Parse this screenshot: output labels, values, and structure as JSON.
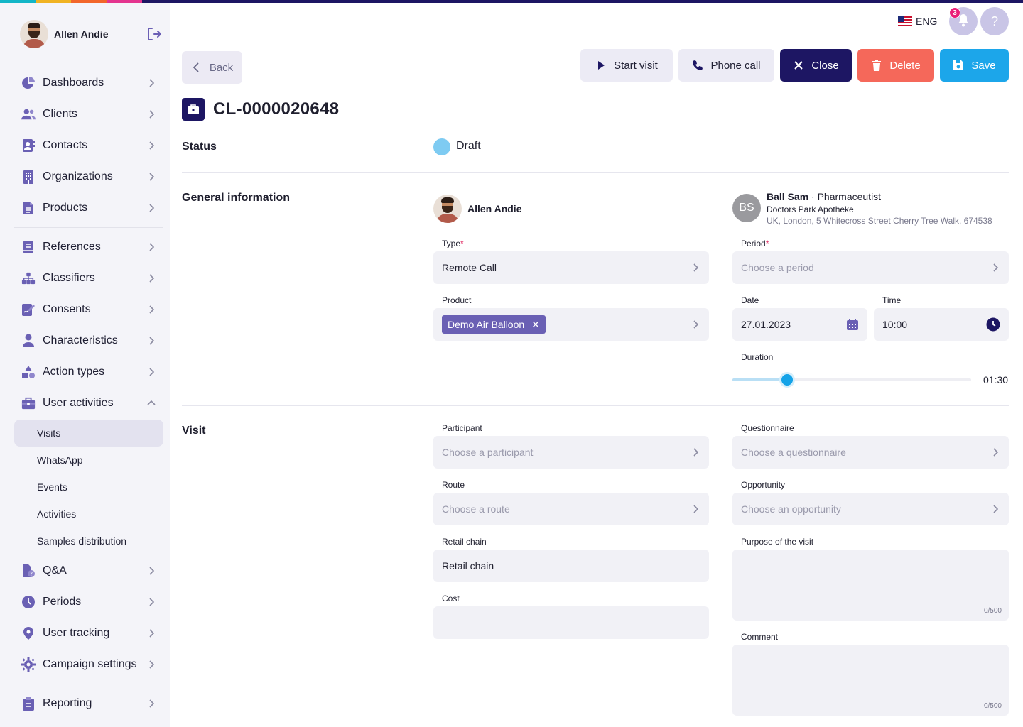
{
  "colors": {
    "accent_bar": [
      "#12b5c7",
      "#f0b324",
      "#f2662b",
      "#e4348f",
      "#1d1663"
    ],
    "primary": "#1d1663",
    "sidebar_icon": "#6a60b4",
    "delete": "#f5685a",
    "save": "#1ca6ea",
    "status_draft": "#7ecbf2"
  },
  "user": {
    "name": "Allen Andie",
    "logout_icon": "logout-icon"
  },
  "sidebar": {
    "items": [
      {
        "label": "Dashboards",
        "icon": "pie-chart-icon"
      },
      {
        "label": "Clients",
        "icon": "users-icon"
      },
      {
        "label": "Contacts",
        "icon": "contact-card-icon"
      },
      {
        "label": "Organizations",
        "icon": "building-icon"
      },
      {
        "label": "Products",
        "icon": "document-icon"
      },
      {
        "label": "References",
        "icon": "book-icon"
      },
      {
        "label": "Classifiers",
        "icon": "hierarchy-icon"
      },
      {
        "label": "Consents",
        "icon": "signature-icon"
      },
      {
        "label": "Characteristics",
        "icon": "person-icon"
      },
      {
        "label": "Action types",
        "icon": "shapes-icon"
      },
      {
        "label": "User activities",
        "icon": "briefcase-icon",
        "expanded": true
      },
      {
        "label": "Q&A",
        "icon": "qa-document-icon"
      },
      {
        "label": "Periods",
        "icon": "clock-icon"
      },
      {
        "label": "User tracking",
        "icon": "location-pin-icon"
      },
      {
        "label": "Campaign settings",
        "icon": "gear-icon"
      },
      {
        "label": "Reporting",
        "icon": "clipboard-icon"
      }
    ],
    "subitems": [
      "Visits",
      "WhatsApp",
      "Events",
      "Activities",
      "Samples distribution"
    ],
    "active_subitem": "Visits"
  },
  "header": {
    "language": "ENG",
    "notifications_count": "3",
    "help_label": "?"
  },
  "toolbar": {
    "back": "Back",
    "start_visit": "Start visit",
    "phone_call": "Phone call",
    "close": "Close",
    "delete": "Delete",
    "save": "Save"
  },
  "record": {
    "id": "CL-0000020648"
  },
  "status": {
    "label": "Status",
    "value": "Draft"
  },
  "general": {
    "section_label": "General information",
    "owner_name": "Allen Andie",
    "client": {
      "initials": "BS",
      "name": "Ball Sam",
      "separator": "·",
      "role": "Pharmaceutist",
      "organization": "Doctors Park Apotheke",
      "address": "UK, London, 5 Whitecross Street Cherry Tree Walk, 674538"
    },
    "type": {
      "label": "Type",
      "required": "*",
      "value": "Remote Call"
    },
    "period": {
      "label": "Period",
      "required": "*",
      "placeholder": "Choose a period"
    },
    "product": {
      "label": "Product",
      "chip": "Demo Air Balloon",
      "chip_remove": "✕"
    },
    "date": {
      "label": "Date",
      "value": "27.01.2023"
    },
    "time": {
      "label": "Time",
      "value": "10:00"
    },
    "duration": {
      "label": "Duration",
      "value": "01:30",
      "fraction": 0.23
    }
  },
  "visit": {
    "section_label": "Visit",
    "participant": {
      "label": "Participant",
      "placeholder": "Choose a participant"
    },
    "questionnaire": {
      "label": "Questionnaire",
      "placeholder": "Choose a questionnaire"
    },
    "route": {
      "label": "Route",
      "placeholder": "Choose a route"
    },
    "opportunity": {
      "label": "Opportunity",
      "placeholder": "Choose an opportunity"
    },
    "retail_chain": {
      "label": "Retail chain",
      "value": "Retail chain"
    },
    "purpose": {
      "label": "Purpose of the visit",
      "counter": "0/500"
    },
    "cost": {
      "label": "Cost",
      "value": ""
    },
    "comment": {
      "label": "Comment",
      "counter": "0/500"
    }
  }
}
